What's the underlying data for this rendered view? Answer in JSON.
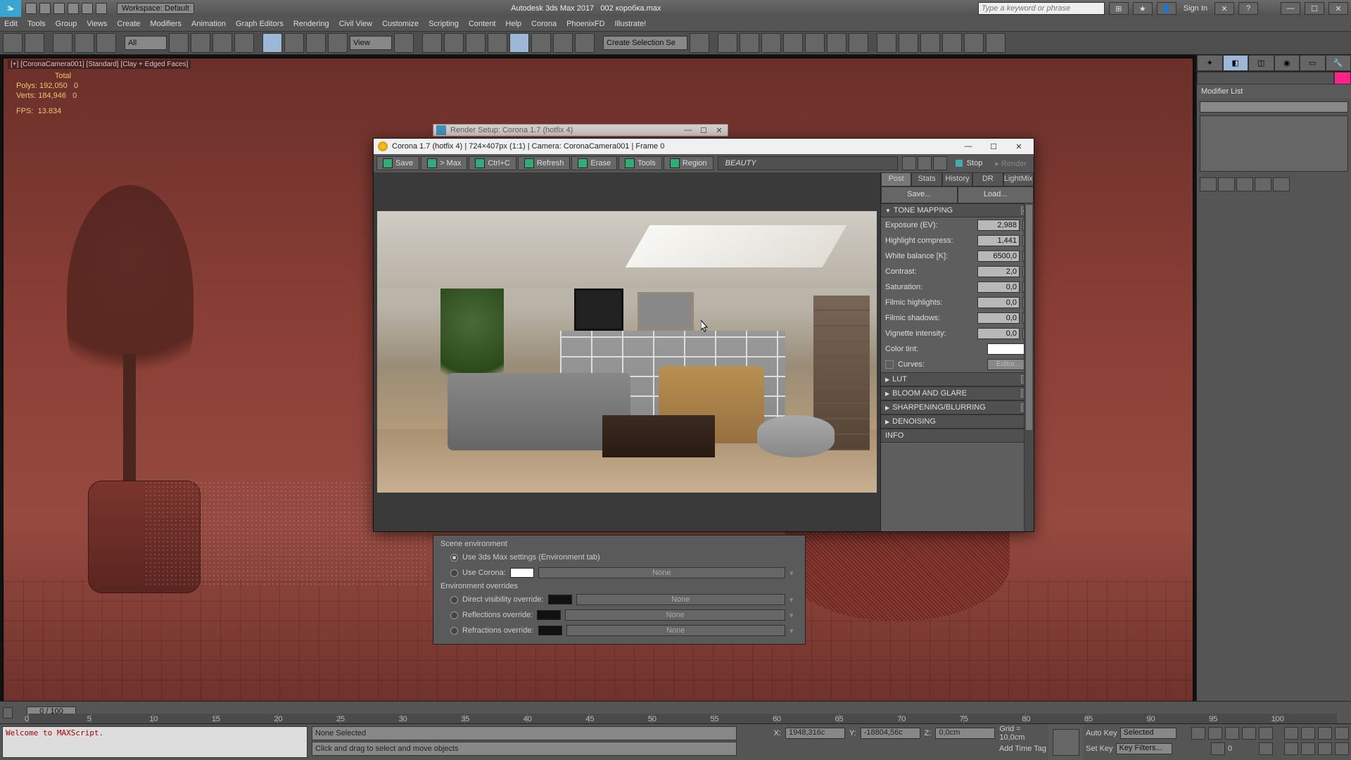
{
  "titlebar": {
    "logo": "3▸",
    "workspace": "Workspace: Default",
    "app": "Autodesk 3ds Max 2017",
    "file": "002 коробка.max",
    "search_placeholder": "Type a keyword or phrase",
    "signin": "Sign In"
  },
  "menu": [
    "Edit",
    "Tools",
    "Group",
    "Views",
    "Create",
    "Modifiers",
    "Animation",
    "Graph Editors",
    "Rendering",
    "Civil View",
    "Customize",
    "Scripting",
    "Content",
    "Help",
    "Corona",
    "PhoenixFD",
    "Illustrate!"
  ],
  "toolbar": {
    "combo_all": "All",
    "combo_view": "View",
    "combo_sel": "Create Selection Se"
  },
  "viewport": {
    "label": "[+] [CoronaCamera001] [Standard] [Clay + Edged Faces]",
    "stats": {
      "total_lbl": "Total",
      "polys_lbl": "Polys:",
      "polys": "192,050",
      "polys_sel": "0",
      "verts_lbl": "Verts:",
      "verts": "184,946",
      "verts_sel": "0",
      "fps_lbl": "FPS:",
      "fps": "13.834"
    }
  },
  "rs_dialog": {
    "title": "Render Setup: Corona 1.7 (hotfix 4)"
  },
  "vfb": {
    "title": "Corona 1.7 (hotfix 4) | 724×407px (1:1) | Camera: CoronaCamera001 | Frame 0",
    "buttons": {
      "save": "Save",
      "max": "> Max",
      "ctrlc": "Ctrl+C",
      "refresh": "Refresh",
      "erase": "Erase",
      "tools": "Tools",
      "region": "Region"
    },
    "beauty": "BEAUTY",
    "stop": "Stop",
    "render": "Render",
    "tabs": [
      "Post",
      "Stats",
      "History",
      "DR",
      "LightMix"
    ],
    "saveload": {
      "save": "Save...",
      "load": "Load..."
    },
    "tone": {
      "hdr": "TONE MAPPING",
      "exposure_lbl": "Exposure (EV):",
      "exposure": "2,988",
      "highlight_lbl": "Highlight compress:",
      "highlight": "1,441",
      "wb_lbl": "White balance [K]:",
      "wb": "6500,0",
      "contrast_lbl": "Contrast:",
      "contrast": "2,0",
      "sat_lbl": "Saturation:",
      "sat": "0,0",
      "fh_lbl": "Filmic highlights:",
      "fh": "0,0",
      "fs_lbl": "Filmic shadows:",
      "fs": "0,0",
      "vig_lbl": "Vignette intensity:",
      "vig": "0,0",
      "tint_lbl": "Color tint:",
      "curves_lbl": "Curves:",
      "curves_btn": "Editor..."
    },
    "rollouts": {
      "lut": "LUT",
      "bloom": "BLOOM AND GLARE",
      "sharp": "SHARPENING/BLURRING",
      "denoise": "DENOISING",
      "info": "INFO"
    }
  },
  "env": {
    "hdr": "Scene environment",
    "use_max": "Use 3ds Max settings (Environment tab)",
    "use_corona": "Use Corona:",
    "overrides_hdr": "Environment overrides",
    "direct": "Direct visibility override:",
    "refl": "Reflections override:",
    "refr": "Refractions override:",
    "none": "None"
  },
  "cmd": {
    "modlist": "Modifier List"
  },
  "timeline": {
    "handle": "0 / 100",
    "ticks": [
      "0",
      "5",
      "10",
      "15",
      "20",
      "25",
      "30",
      "35",
      "40",
      "45",
      "50",
      "55",
      "60",
      "65",
      "70",
      "75",
      "80",
      "85",
      "90",
      "95",
      "100"
    ]
  },
  "status": {
    "script": "Welcome to MAXScript.",
    "sel": "None Selected",
    "prompt": "Click and drag to select and move objects",
    "x_lbl": "X:",
    "x": "1948,316c",
    "y_lbl": "Y:",
    "y": "-18804,56c",
    "z_lbl": "Z:",
    "z": "0,0cm",
    "grid": "Grid = 10,0cm",
    "addtime": "Add Time Tag",
    "autokey": "Auto Key",
    "selected": "Selected",
    "setkey": "Set Key",
    "keyfilt": "Key Filters..."
  }
}
